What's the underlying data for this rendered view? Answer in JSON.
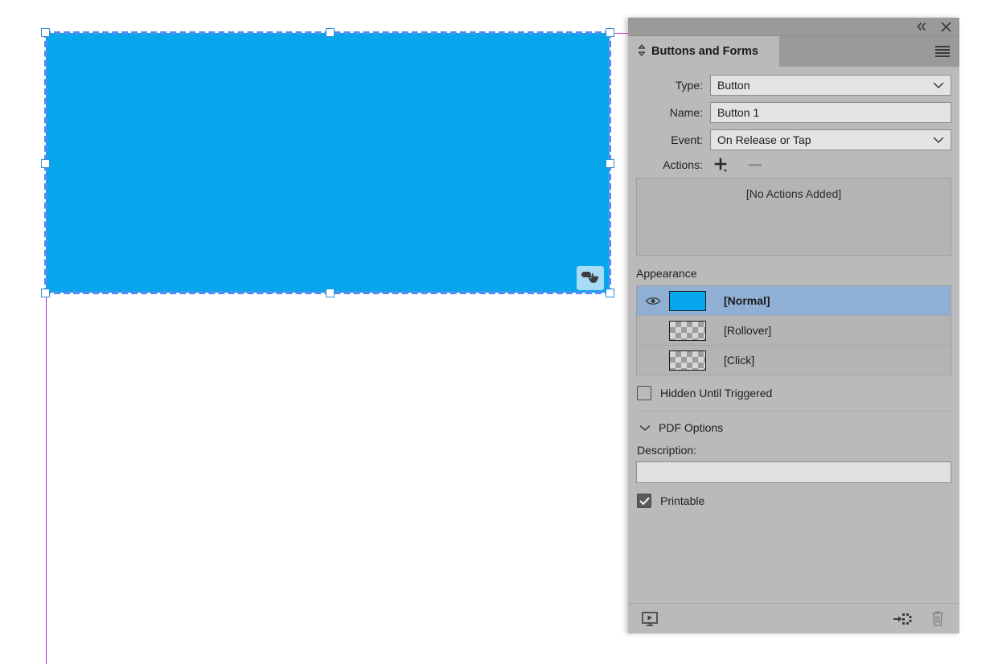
{
  "panel": {
    "title": "Buttons and Forms",
    "titlebar": {
      "collapse_label": "«",
      "close_label": "×",
      "collapse_icon": "collapse-to-icons-icon",
      "close_icon": "close-icon"
    },
    "menu_icon": "panel-menu-icon",
    "tab_sort_icon": "tab-sort-icon",
    "fields": [
      {
        "label": "Type:",
        "value": "Button",
        "control": "select",
        "name": "type"
      },
      {
        "label": "Name:",
        "value": "Button 1",
        "control": "text",
        "name": "name"
      },
      {
        "label": "Event:",
        "value": "On Release or Tap",
        "control": "select",
        "name": "event"
      }
    ],
    "actions": {
      "label": "Actions:",
      "add_icon": "add-action-icon",
      "remove_icon": "remove-action-icon",
      "empty_text": "[No Actions Added]"
    },
    "appearance": {
      "title": "Appearance",
      "rows": [
        {
          "label": "[Normal]",
          "selected": true,
          "visible": true,
          "swatch": "solid",
          "eye_icon": "eye-visible-icon"
        },
        {
          "label": "[Rollover]",
          "selected": false,
          "visible": false,
          "swatch": "transparent",
          "eye_icon": ""
        },
        {
          "label": "[Click]",
          "selected": false,
          "visible": false,
          "swatch": "transparent",
          "eye_icon": ""
        }
      ]
    },
    "hidden_until_triggered": {
      "label": "Hidden Until Triggered",
      "checked": false
    },
    "pdf_options": {
      "label": "PDF Options",
      "expanded": true,
      "chevron_icon": "chevron-down-icon"
    },
    "description": {
      "label": "Description:",
      "value": "",
      "placeholder": ""
    },
    "printable": {
      "label": "Printable",
      "checked": true
    },
    "footer": {
      "preview_icon": "preview-spread-icon",
      "convert_icon": "convert-to-object-icon",
      "delete_icon": "delete-icon"
    }
  },
  "canvas": {
    "selection": {
      "fill_color": "#05A6EC",
      "selection_border_color": "#4F8EF0",
      "handle_color": "#FFFFFF",
      "guide_color": "#9933DD"
    },
    "button_badge_icon": "button-indicator-hand-icon"
  },
  "colors": {
    "panel_background": "#BABABA",
    "panel_chrome": "#9A9A9A",
    "selected_row": "#8FAFD4",
    "field_background": "#E3E3E3",
    "accent": "#05A6EC"
  }
}
